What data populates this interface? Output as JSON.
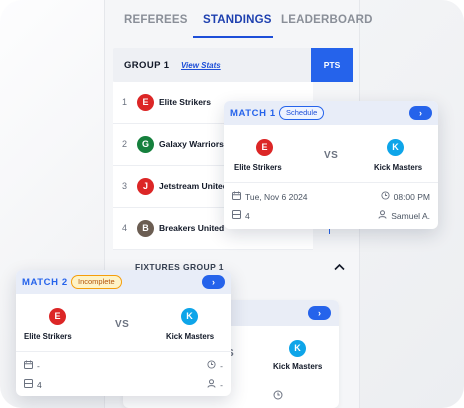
{
  "colors": {
    "accent": "#2563eb",
    "team_e": "#dc2626",
    "team_g": "#15803d",
    "team_j": "#dc2626",
    "team_b": "#6b5d52",
    "team_k": "#0ea5e9",
    "incomplete": "#f59e0b"
  },
  "tabs": {
    "referees": "REFEREES",
    "standings": "STANDINGS",
    "leaderboard": "LEADERBOARD",
    "active": "standings"
  },
  "group": {
    "title": "GROUP 1",
    "view_stats": "View Stats",
    "pts_header": "PTS"
  },
  "standings": [
    {
      "rank": "1",
      "badge": "E",
      "team": "Elite Strikers"
    },
    {
      "rank": "2",
      "badge": "G",
      "team": "Galaxy Warriors"
    },
    {
      "rank": "3",
      "badge": "J",
      "team": "Jetstream United"
    },
    {
      "rank": "4",
      "badge": "B",
      "team": "Breakers United"
    }
  ],
  "fixtures": {
    "title": "FIXTURES GROUP 1",
    "bg_vs": "S",
    "bg_away_badge": "K",
    "bg_away_team": "Kick Masters"
  },
  "match1": {
    "label": "MATCH 1",
    "status": "Schedule",
    "next": "›",
    "home_badge": "E",
    "home_team": "Elite Strikers",
    "vs": "VS",
    "away_badge": "K",
    "away_team": "Kick Masters",
    "date": "Tue, Nov 6 2024",
    "time": "08:00 PM",
    "field": "4",
    "referee": "Samuel A."
  },
  "match2": {
    "label": "MATCH 2",
    "status": "Incomplete",
    "next": "›",
    "home_badge": "E",
    "home_team": "Elite Strikers",
    "vs": "VS",
    "away_badge": "K",
    "away_team": "Kick Masters",
    "date": "-",
    "time": "-",
    "field": "4",
    "referee": "-"
  },
  "icons": {
    "calendar": "calendar-icon",
    "clock": "clock-icon",
    "field": "field-icon",
    "referee": "referee-icon",
    "next": "chevron-right-icon",
    "collapse": "chevron-up-icon"
  }
}
